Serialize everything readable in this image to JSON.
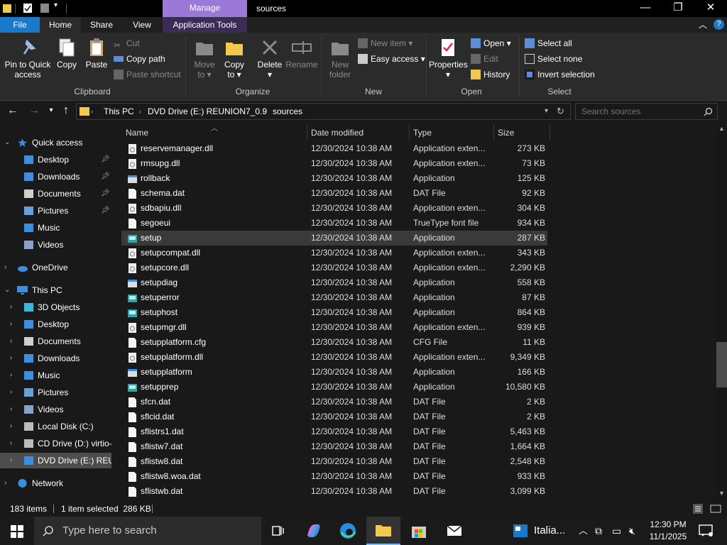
{
  "titlebar": {
    "manage_label": "Manage",
    "window_title": "sources",
    "minimize": "—",
    "maximize": "❐",
    "close": "✕"
  },
  "ribbon_tabs": {
    "file": "File",
    "home": "Home",
    "share": "Share",
    "view": "View",
    "app_tools": "Application Tools"
  },
  "ribbon": {
    "clipboard": {
      "pin": "Pin to Quick",
      "pin2": "access",
      "copy": "Copy",
      "paste": "Paste",
      "cut": "Cut",
      "copy_path": "Copy path",
      "paste_shortcut": "Paste shortcut",
      "label": "Clipboard"
    },
    "organize": {
      "move": "Move",
      "move2": "to ▾",
      "copyto": "Copy",
      "copyto2": "to ▾",
      "delete": "Delete",
      "delete2": "▾",
      "rename": "Rename",
      "label": "Organize"
    },
    "new": {
      "new_folder": "New",
      "new_folder2": "folder",
      "new_item": "New item ▾",
      "easy_access": "Easy access ▾",
      "label": "New"
    },
    "open": {
      "properties": "Properties",
      "properties2": "▾",
      "open": "Open ▾",
      "edit": "Edit",
      "history": "History",
      "label": "Open"
    },
    "select": {
      "select_all": "Select all",
      "select_none": "Select none",
      "invert": "Invert selection",
      "label": "Select"
    }
  },
  "address": {
    "crumbs": [
      "This PC",
      "DVD Drive (E:) REUNION7_0.9",
      "sources"
    ],
    "search_placeholder": "Search sources"
  },
  "nav_pane": {
    "quick_access": "Quick access",
    "quick_items": [
      {
        "label": "Desktop",
        "pinned": true
      },
      {
        "label": "Downloads",
        "pinned": true
      },
      {
        "label": "Documents",
        "pinned": true
      },
      {
        "label": "Pictures",
        "pinned": true
      },
      {
        "label": "Music",
        "pinned": false
      },
      {
        "label": "Videos",
        "pinned": false
      }
    ],
    "onedrive": "OneDrive",
    "this_pc": "This PC",
    "pc_items": [
      "3D Objects",
      "Desktop",
      "Documents",
      "Downloads",
      "Music",
      "Pictures",
      "Videos",
      "Local Disk (C:)",
      "CD Drive (D:) virtio-",
      "DVD Drive (E:) REUN"
    ],
    "network": "Network"
  },
  "columns": {
    "name": "Name",
    "date": "Date modified",
    "type": "Type",
    "size": "Size"
  },
  "files": [
    {
      "name": "reservemanager.dll",
      "date": "12/30/2024 10:38 AM",
      "type": "Application exten...",
      "size": "273 KB",
      "icon": "dll"
    },
    {
      "name": "rmsupg.dll",
      "date": "12/30/2024 10:38 AM",
      "type": "Application exten...",
      "size": "73 KB",
      "icon": "dll"
    },
    {
      "name": "rollback",
      "date": "12/30/2024 10:38 AM",
      "type": "Application",
      "size": "125 KB",
      "icon": "app"
    },
    {
      "name": "schema.dat",
      "date": "12/30/2024 10:38 AM",
      "type": "DAT File",
      "size": "92 KB",
      "icon": "file"
    },
    {
      "name": "sdbapiu.dll",
      "date": "12/30/2024 10:38 AM",
      "type": "Application exten...",
      "size": "304 KB",
      "icon": "dll"
    },
    {
      "name": "segoeui",
      "date": "12/30/2024 10:38 AM",
      "type": "TrueType font file",
      "size": "934 KB",
      "icon": "file"
    },
    {
      "name": "setup",
      "date": "12/30/2024 10:38 AM",
      "type": "Application",
      "size": "287 KB",
      "icon": "setup",
      "selected": true
    },
    {
      "name": "setupcompat.dll",
      "date": "12/30/2024 10:38 AM",
      "type": "Application exten...",
      "size": "343 KB",
      "icon": "dll"
    },
    {
      "name": "setupcore.dll",
      "date": "12/30/2024 10:38 AM",
      "type": "Application exten...",
      "size": "2,290 KB",
      "icon": "dll"
    },
    {
      "name": "setupdiag",
      "date": "12/30/2024 10:38 AM",
      "type": "Application",
      "size": "558 KB",
      "icon": "app"
    },
    {
      "name": "setuperror",
      "date": "12/30/2024 10:38 AM",
      "type": "Application",
      "size": "87 KB",
      "icon": "setup"
    },
    {
      "name": "setuphost",
      "date": "12/30/2024 10:38 AM",
      "type": "Application",
      "size": "864 KB",
      "icon": "setup"
    },
    {
      "name": "setupmgr.dll",
      "date": "12/30/2024 10:38 AM",
      "type": "Application exten...",
      "size": "939 KB",
      "icon": "dll"
    },
    {
      "name": "setupplatform.cfg",
      "date": "12/30/2024 10:38 AM",
      "type": "CFG File",
      "size": "11 KB",
      "icon": "file"
    },
    {
      "name": "setupplatform.dll",
      "date": "12/30/2024 10:38 AM",
      "type": "Application exten...",
      "size": "9,349 KB",
      "icon": "dll"
    },
    {
      "name": "setupplatform",
      "date": "12/30/2024 10:38 AM",
      "type": "Application",
      "size": "166 KB",
      "icon": "app"
    },
    {
      "name": "setupprep",
      "date": "12/30/2024 10:38 AM",
      "type": "Application",
      "size": "10,580 KB",
      "icon": "setup"
    },
    {
      "name": "sfcn.dat",
      "date": "12/30/2024 10:38 AM",
      "type": "DAT File",
      "size": "2 KB",
      "icon": "file"
    },
    {
      "name": "sflcid.dat",
      "date": "12/30/2024 10:38 AM",
      "type": "DAT File",
      "size": "2 KB",
      "icon": "file"
    },
    {
      "name": "sflistrs1.dat",
      "date": "12/30/2024 10:38 AM",
      "type": "DAT File",
      "size": "5,463 KB",
      "icon": "file"
    },
    {
      "name": "sflistw7.dat",
      "date": "12/30/2024 10:38 AM",
      "type": "DAT File",
      "size": "1,664 KB",
      "icon": "file"
    },
    {
      "name": "sflistw8.dat",
      "date": "12/30/2024 10:38 AM",
      "type": "DAT File",
      "size": "2,548 KB",
      "icon": "file"
    },
    {
      "name": "sflistw8.woa.dat",
      "date": "12/30/2024 10:38 AM",
      "type": "DAT File",
      "size": "933 KB",
      "icon": "file"
    },
    {
      "name": "sflistwb.dat",
      "date": "12/30/2024 10:38 AM",
      "type": "DAT File",
      "size": "3,099 KB",
      "icon": "file"
    }
  ],
  "status": {
    "items": "183 items",
    "selected": "1 item selected  286 KB"
  },
  "taskbar": {
    "search_placeholder": "Type here to search",
    "weather": "Italia...",
    "time": "12:30 PM",
    "date": "11/1/2025"
  },
  "colors": {
    "accent": "#1979ca",
    "manage": "#9b79d8",
    "folder": "#f2c94c"
  }
}
